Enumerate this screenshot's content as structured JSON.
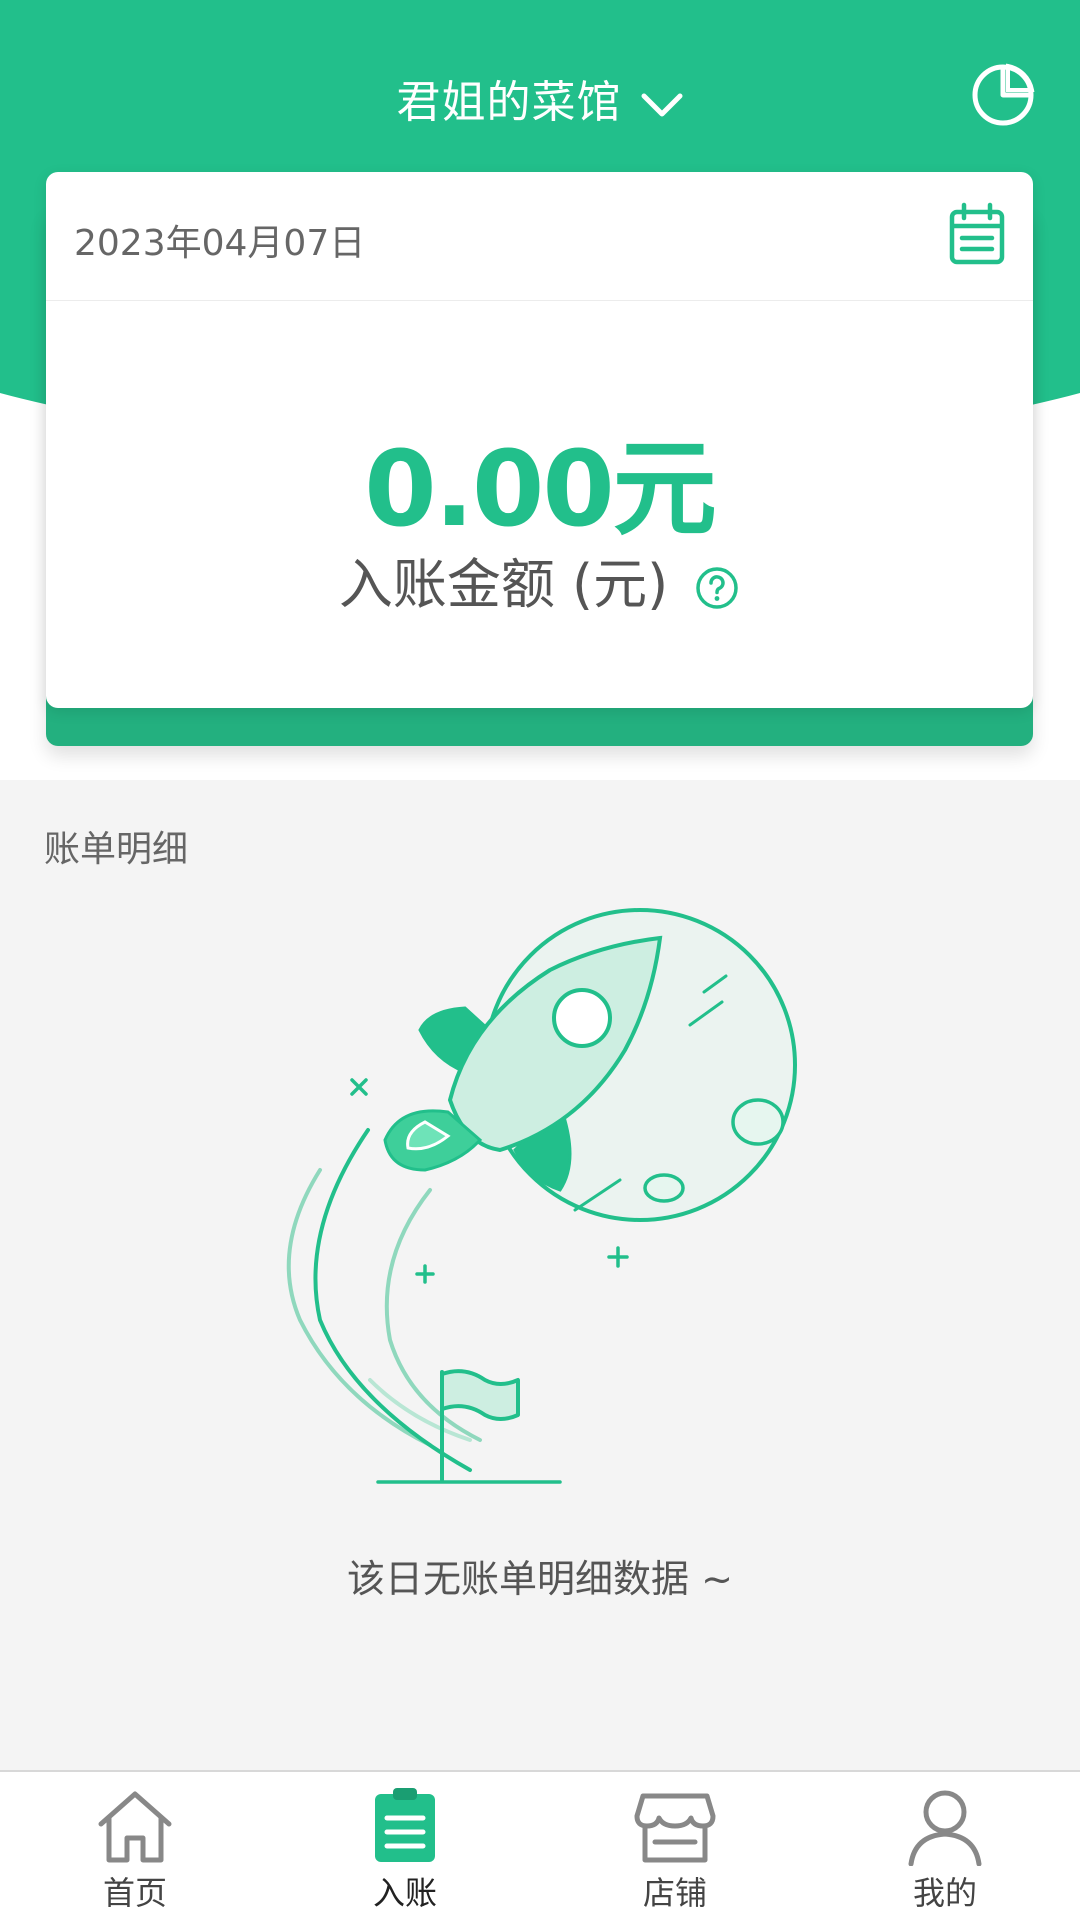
{
  "header": {
    "store_name": "君姐的菜馆",
    "dropdown_icon": "chevron-down-icon",
    "stats_icon": "pie-chart-icon"
  },
  "summary": {
    "date": "2023年04月07日",
    "calendar_icon": "calendar-icon",
    "amount": "0.00元",
    "amount_label": "入账金额 (元)",
    "help_icon": "question-circle-icon"
  },
  "details": {
    "title": "账单明细",
    "empty_text": "该日无账单明细数据 ~"
  },
  "tabbar": {
    "tabs": [
      {
        "label": "首页",
        "icon": "home-icon",
        "active": false
      },
      {
        "label": "入账",
        "icon": "clipboard-icon",
        "active": true
      },
      {
        "label": "店铺",
        "icon": "store-icon",
        "active": false
      },
      {
        "label": "我的",
        "icon": "user-icon",
        "active": false
      }
    ]
  },
  "colors": {
    "primary": "#22bf8b",
    "primary_dark": "#23b07f",
    "background": "#f4f4f4",
    "text_gray": "#666666"
  }
}
